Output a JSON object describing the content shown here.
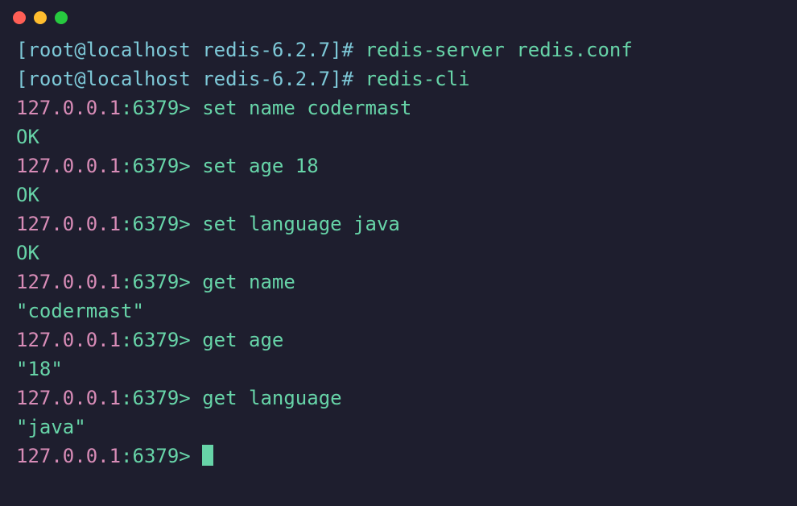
{
  "lines": [
    {
      "type": "shell",
      "prompt": "[root@localhost redis-6.2.7]# ",
      "cmd": "redis-server redis.conf"
    },
    {
      "type": "shell",
      "prompt": "[root@localhost redis-6.2.7]# ",
      "cmd": "redis-cli"
    },
    {
      "type": "redis",
      "ip": "127.0.0.1",
      "port": ":6379> ",
      "cmd": "set name codermast"
    },
    {
      "type": "output",
      "text": "OK"
    },
    {
      "type": "redis",
      "ip": "127.0.0.1",
      "port": ":6379> ",
      "cmd": "set age 18"
    },
    {
      "type": "output",
      "text": "OK"
    },
    {
      "type": "redis",
      "ip": "127.0.0.1",
      "port": ":6379> ",
      "cmd": "set language java"
    },
    {
      "type": "output",
      "text": "OK"
    },
    {
      "type": "redis",
      "ip": "127.0.0.1",
      "port": ":6379> ",
      "cmd": "get name"
    },
    {
      "type": "output",
      "text": "\"codermast\""
    },
    {
      "type": "redis",
      "ip": "127.0.0.1",
      "port": ":6379> ",
      "cmd": "get age"
    },
    {
      "type": "output",
      "text": "\"18\""
    },
    {
      "type": "redis",
      "ip": "127.0.0.1",
      "port": ":6379> ",
      "cmd": "get language"
    },
    {
      "type": "output",
      "text": "\"java\""
    },
    {
      "type": "redis-cursor",
      "ip": "127.0.0.1",
      "port": ":6379> "
    }
  ]
}
